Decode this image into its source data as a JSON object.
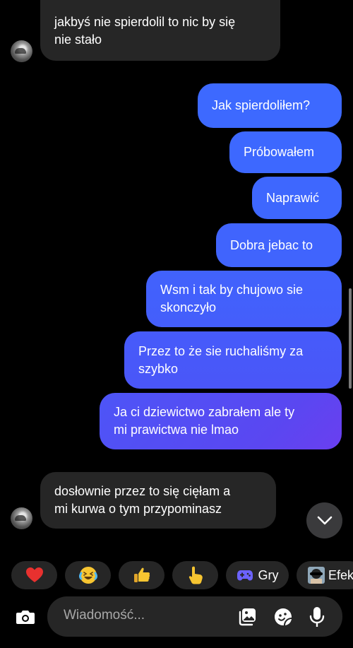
{
  "colors": {
    "background": "#000000",
    "incoming_bubble": "#262626",
    "outgoing_top": "#3d69ff",
    "outgoing_bottom": "#5d46f0",
    "chip_background": "#262626"
  },
  "messages": [
    {
      "dir": "in",
      "lines": [
        "jakbyś nie spierdolil to nic by się",
        "nie stało"
      ],
      "avatar": true
    },
    {
      "dir": "out",
      "lines": [
        "Jak spierdoliłem?"
      ]
    },
    {
      "dir": "out",
      "lines": [
        "Próbowałem"
      ]
    },
    {
      "dir": "out",
      "lines": [
        "Naprawić"
      ]
    },
    {
      "dir": "out",
      "lines": [
        "Dobra jebac to"
      ]
    },
    {
      "dir": "out",
      "lines": [
        "Wsm i tak by chujowo sie",
        "skonczyło"
      ]
    },
    {
      "dir": "out",
      "lines": [
        "Przez to że sie ruchaliśmy za",
        "szybko"
      ]
    },
    {
      "dir": "out",
      "lines": [
        "Ja ci dziewictwo zabrałem ale ty",
        "mi prawictwa nie lmao"
      ]
    },
    {
      "dir": "in",
      "lines": [
        "dosłownie przez to się cięłam a",
        "mi kurwa o tym przypominasz"
      ],
      "avatar": true
    }
  ],
  "quick_reactions": {
    "items": [
      "heart-emoji",
      "laughing-emoji",
      "thumbs-up-emoji",
      "pointing-emoji"
    ],
    "games_label": "Gry",
    "effects_label": "Efek"
  },
  "composer": {
    "placeholder": "Wiadomość..."
  },
  "icons": {
    "camera": "camera-icon",
    "gallery": "gallery-icon",
    "sticker": "sticker-icon",
    "microphone": "microphone-icon",
    "scroll_down": "chevron-down-icon",
    "games": "gamepad-icon"
  }
}
